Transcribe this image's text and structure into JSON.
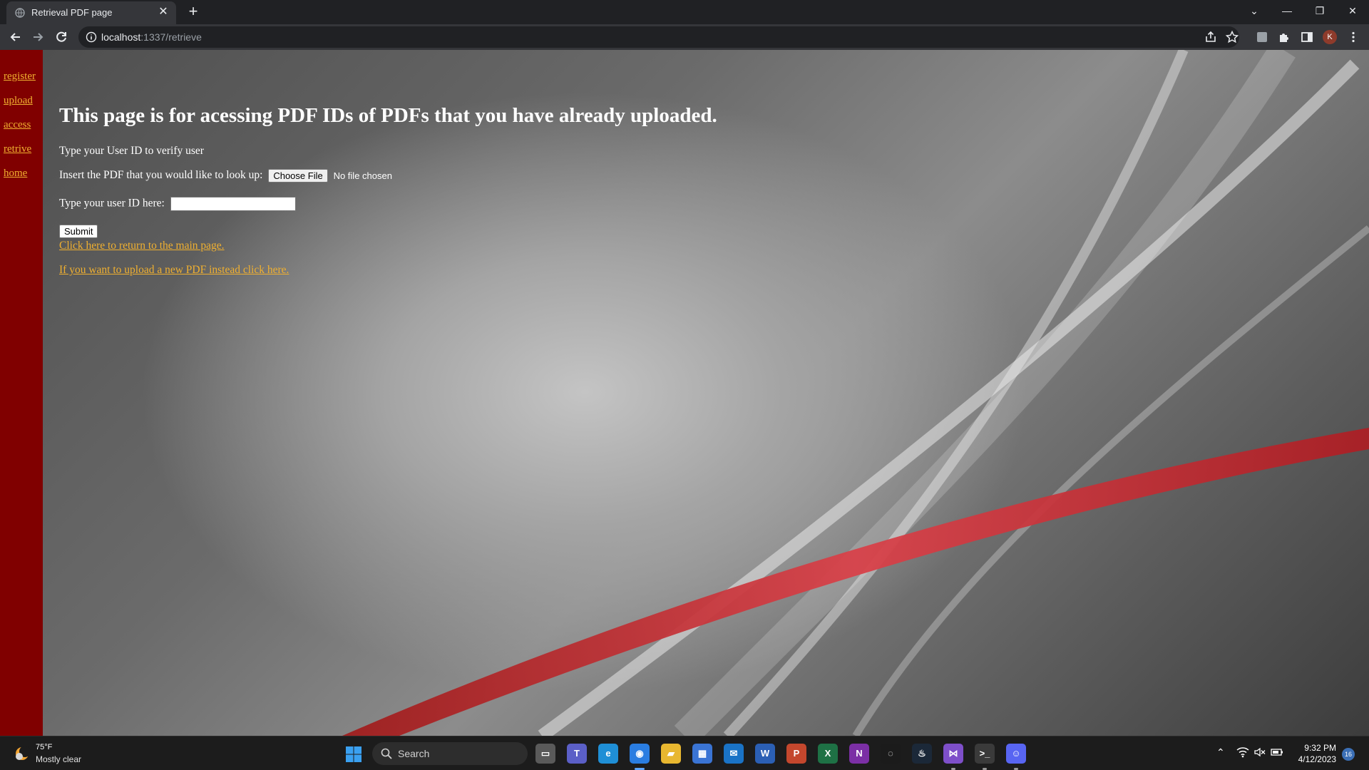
{
  "browser": {
    "tab_title": "Retrieval PDF page",
    "url_host": "localhost",
    "url_path": ":1337/retrieve",
    "new_tab_label": "+",
    "close_tab_label": "✕",
    "profile_initial": "K",
    "window_controls": [
      "⌄",
      "—",
      "❐",
      "✕"
    ]
  },
  "sidebar": {
    "items": [
      {
        "label": "register"
      },
      {
        "label": "upload"
      },
      {
        "label": "access"
      },
      {
        "label": "retrive"
      },
      {
        "label": "home"
      }
    ]
  },
  "page": {
    "heading": "This page is for acessing PDF IDs of PDFs that you have already uploaded.",
    "verify_text": "Type your User ID to verify user",
    "pdf_label": "Insert the PDF that you would like to look up:",
    "file_button": "Choose File",
    "file_status": "No file chosen",
    "user_id_label": "Type your user ID here:",
    "user_id_value": "",
    "submit_label": "Submit",
    "return_link": "Click here to return to the main page.",
    "upload_link": "If you want to upload a new PDF instead click here."
  },
  "colors": {
    "sidebar_bg": "#800000",
    "link": "#f0b030",
    "accent_red": "#c8282e"
  },
  "taskbar": {
    "weather_temp": "75°F",
    "weather_desc": "Mostly clear",
    "search_label": "Search",
    "time": "9:32 PM",
    "date": "4/12/2023",
    "notification_count": "16",
    "apps": [
      {
        "name": "task-view",
        "glyph": "▭",
        "color": "#5a5a5a"
      },
      {
        "name": "teams",
        "glyph": "T",
        "color": "#5b5fc7"
      },
      {
        "name": "edge",
        "glyph": "e",
        "color": "#1f8fd6"
      },
      {
        "name": "chrome",
        "glyph": "◉",
        "color": "#2a7de1"
      },
      {
        "name": "file-explorer",
        "glyph": "▰",
        "color": "#e8b730"
      },
      {
        "name": "store",
        "glyph": "▦",
        "color": "#3a74d4"
      },
      {
        "name": "mail",
        "glyph": "✉",
        "color": "#1a73c6"
      },
      {
        "name": "word",
        "glyph": "W",
        "color": "#2b5fb4"
      },
      {
        "name": "powerpoint",
        "glyph": "P",
        "color": "#c4472d"
      },
      {
        "name": "excel",
        "glyph": "X",
        "color": "#1e7145"
      },
      {
        "name": "onenote",
        "glyph": "N",
        "color": "#7b2fa5"
      },
      {
        "name": "refresh-app",
        "glyph": "◌",
        "color": "#1b1b1b"
      },
      {
        "name": "steam",
        "glyph": "♨",
        "color": "#1b2838"
      },
      {
        "name": "visual-studio",
        "glyph": "⋈",
        "color": "#7e4fc9"
      },
      {
        "name": "terminal",
        "glyph": ">_",
        "color": "#3a3a3a"
      },
      {
        "name": "discord",
        "glyph": "☺",
        "color": "#5865f2"
      }
    ]
  }
}
